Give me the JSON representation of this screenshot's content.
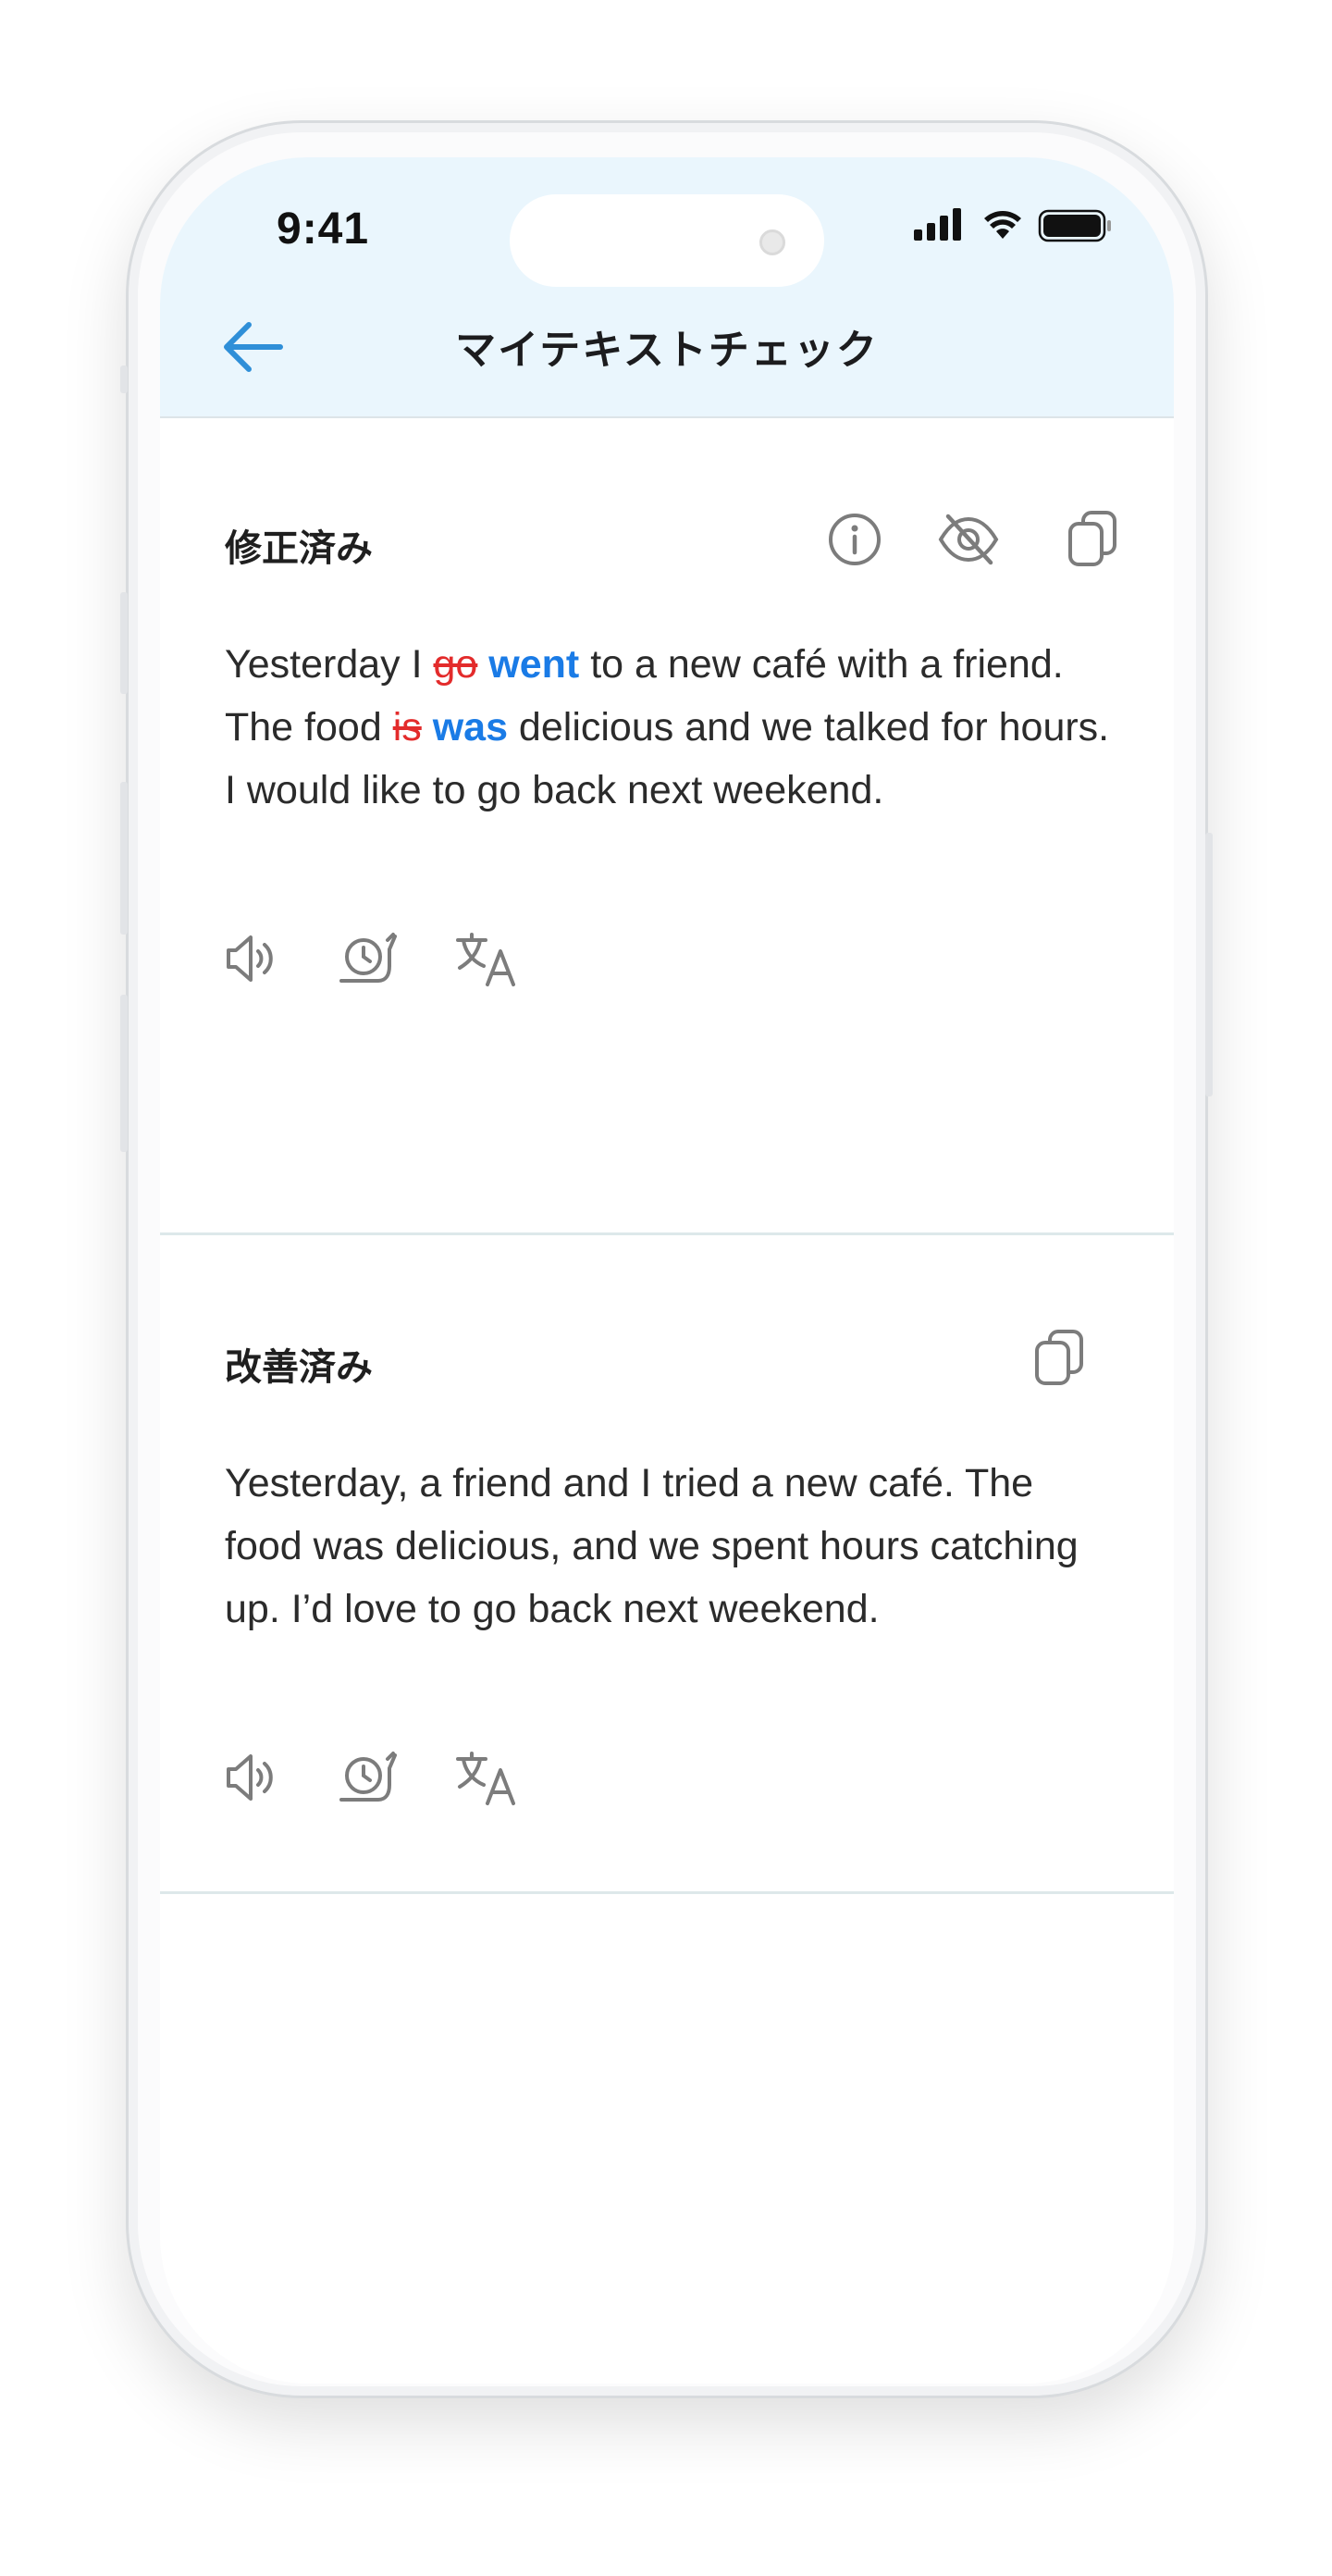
{
  "status_bar": {
    "time": "9:41"
  },
  "header": {
    "title": "マイテキストチェック"
  },
  "corrected": {
    "title": "修正済み",
    "text_parts": {
      "p1": "Yesterday I ",
      "del1": "go",
      "ins1": "went",
      "p2": " to a new café with a friend. The food ",
      "del2": "is",
      "ins2": "was",
      "p3": " delicious and we talked for hours. I would like to go back next weekend."
    }
  },
  "improved": {
    "title": "改善済み",
    "text": "Yesterday, a friend and I tried a new café. The food was delicious, and we spent hours catching up. I’d love to go back next weekend."
  },
  "icons": {
    "back": "arrow-left-icon",
    "info": "info-icon",
    "hide": "eye-off-icon",
    "copy": "copy-icon",
    "speaker": "speaker-icon",
    "slow": "snail-icon",
    "translate": "translate-icon"
  },
  "colors": {
    "accent": "#1a7be6",
    "deletion": "#e32b2b",
    "header_bg": "#eaf6fd"
  }
}
